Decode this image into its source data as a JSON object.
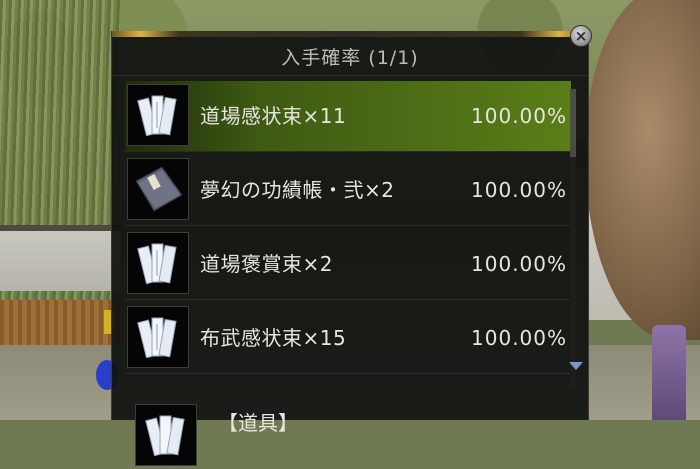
{
  "panel": {
    "title": "入手確率 (1/1)",
    "close_icon": "×"
  },
  "items": [
    {
      "name": "道場感状束×11",
      "rate": "100.00%",
      "icon": "paper-scrolls-icon",
      "selected": true
    },
    {
      "name": "夢幻の功績帳・弐×2",
      "rate": "100.00%",
      "icon": "ledger-book-icon",
      "selected": false
    },
    {
      "name": "道場褒賞束×2",
      "rate": "100.00%",
      "icon": "paper-scrolls-icon",
      "selected": false
    },
    {
      "name": "布武感状束×15",
      "rate": "100.00%",
      "icon": "paper-scrolls-icon",
      "selected": false
    }
  ],
  "partial_item": {
    "label": "【道具】",
    "icon": "paper-scrolls-icon"
  },
  "colors": {
    "selected_row": "#5b7e18",
    "panel_bg": "#101210",
    "accent_gold": "#e3b445",
    "scroll_arrow": "#7f95cc"
  }
}
